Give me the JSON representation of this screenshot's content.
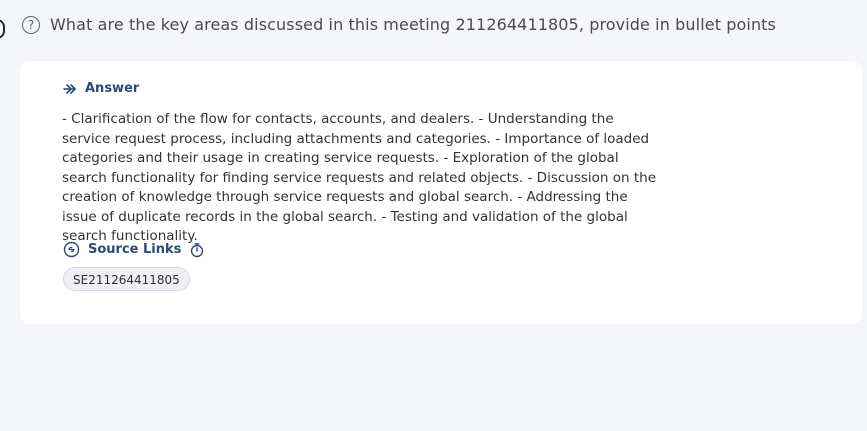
{
  "question": {
    "text": "What are the key areas discussed in this meeting 211264411805, provide in bullet points"
  },
  "answer": {
    "label": "Answer",
    "text": "- Clarification of the flow for contacts, accounts, and dealers. - Understanding the service request process, including attachments and categories. - Importance of loaded categories and their usage in creating service requests. - Exploration of the global search functionality for finding service requests and related objects. - Discussion on the creation of knowledge through service requests and global search. - Addressing the issue of duplicate records in the global search. - Testing and validation of the global search functionality."
  },
  "sources": {
    "label": "Source Links",
    "items": [
      {
        "label": "SE211264411805"
      }
    ]
  },
  "icons": {
    "question": "question-circle-icon",
    "answer": "answer-arrows-icon",
    "source_links": "link-icon",
    "timer": "timer-icon"
  },
  "colors": {
    "accent": "#2a4b78",
    "background": "#f5f6fa",
    "card": "#ffffff",
    "chip_background": "#eef0f5",
    "chip_border": "#d5d9e3"
  }
}
